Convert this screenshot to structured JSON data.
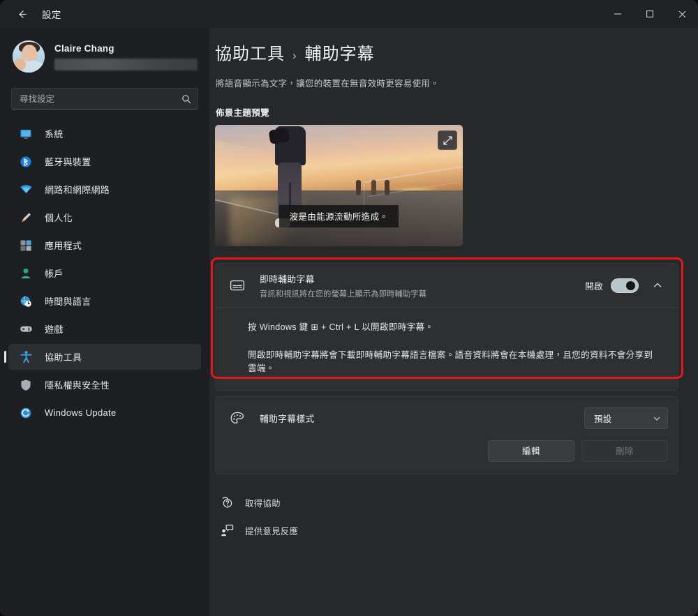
{
  "window": {
    "title": "設定",
    "back_icon": "back-arrow-icon",
    "controls": {
      "minimize": "minimize-icon",
      "maximize": "maximize-icon",
      "close": "close-icon"
    }
  },
  "sidebar": {
    "profile": {
      "name": "Claire Chang",
      "email_redacted": true,
      "avatar_icon": "user-avatar-photo"
    },
    "search": {
      "placeholder": "尋找設定",
      "value": "",
      "icon": "search-icon"
    },
    "items": [
      {
        "label": "系統",
        "icon": "system-monitor-icon",
        "selected": false
      },
      {
        "label": "藍牙與裝置",
        "icon": "bluetooth-icon",
        "selected": false
      },
      {
        "label": "網路和網際網路",
        "icon": "wifi-icon",
        "selected": false
      },
      {
        "label": "個人化",
        "icon": "paintbrush-icon",
        "selected": false
      },
      {
        "label": "應用程式",
        "icon": "apps-grid-icon",
        "selected": false
      },
      {
        "label": "帳戶",
        "icon": "account-person-icon",
        "selected": false
      },
      {
        "label": "時間與語言",
        "icon": "clock-globe-icon",
        "selected": false
      },
      {
        "label": "遊戲",
        "icon": "gamepad-icon",
        "selected": false
      },
      {
        "label": "協助工具",
        "icon": "accessibility-person-icon",
        "selected": true
      },
      {
        "label": "隱私權與安全性",
        "icon": "shield-icon",
        "selected": false
      },
      {
        "label": "Windows Update",
        "icon": "update-refresh-icon",
        "selected": false
      }
    ]
  },
  "main": {
    "breadcrumb": {
      "parent": "協助工具",
      "separator": "›",
      "current": "輔助字幕"
    },
    "description": "將語音顯示為文字，讓您的裝置在無音效時更容易使用。",
    "preview": {
      "section_label": "佈景主題預覽",
      "caption_text": "波是由能源流動所造成。",
      "expand_icon": "expand-fullscreen-icon"
    },
    "live_captions": {
      "icon": "live-captions-icon",
      "title": "即時輔助字幕",
      "subtitle": "音訊和視訊將在您的螢幕上顯示為即時輔助字幕",
      "toggle_label": "開啟",
      "toggle_state": "on",
      "chevron_icon": "chevron-up-icon",
      "expanded_lines": [
        "按 Windows 鍵 ⊞ + Ctrl + L 以開啟即時字幕。",
        "開啟即時輔助字幕將會下載即時輔助字幕語言檔案。語音資料將會在本機處理，且您的資料不會分享到雲端。"
      ]
    },
    "caption_style": {
      "icon": "palette-icon",
      "title": "輔助字幕樣式",
      "dropdown": {
        "value": "預設",
        "chevron_icon": "chevron-down-icon"
      },
      "edit_button": "編輯",
      "delete_button": "刪除",
      "delete_disabled": true
    },
    "footer_links": [
      {
        "label": "取得協助",
        "icon": "help-question-icon"
      },
      {
        "label": "提供意見反應",
        "icon": "feedback-icon"
      }
    ]
  },
  "annotation": {
    "color": "#e8151c",
    "target": "即時輔助字幕"
  }
}
